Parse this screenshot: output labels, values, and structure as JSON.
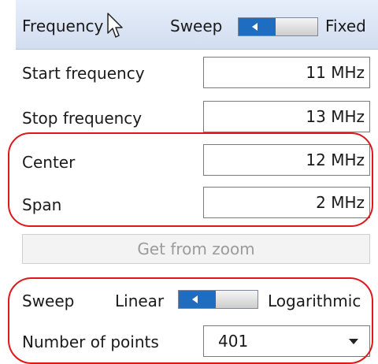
{
  "frequency": {
    "title": "Frequency",
    "mode_label": "Sweep",
    "mode_off_label": "Fixed",
    "toggle_state": "sweep"
  },
  "fields": [
    {
      "label": "Start frequency",
      "value": "11 MHz"
    },
    {
      "label": "Stop frequency",
      "value": "13 MHz"
    },
    {
      "label": "Center",
      "value": "12 MHz"
    },
    {
      "label": "Span",
      "value": "2 MHz"
    }
  ],
  "zoom_button": {
    "label": "Get from zoom",
    "enabled": false
  },
  "sweep": {
    "title": "Sweep",
    "option_left": "Linear",
    "option_right": "Logarithmic",
    "toggle_state": "linear"
  },
  "points": {
    "label": "Number of points",
    "value": "401"
  },
  "colors": {
    "accent": "#1f6dc0",
    "highlight_ring": "#e0171b",
    "header_bg": "#dce5f3"
  }
}
